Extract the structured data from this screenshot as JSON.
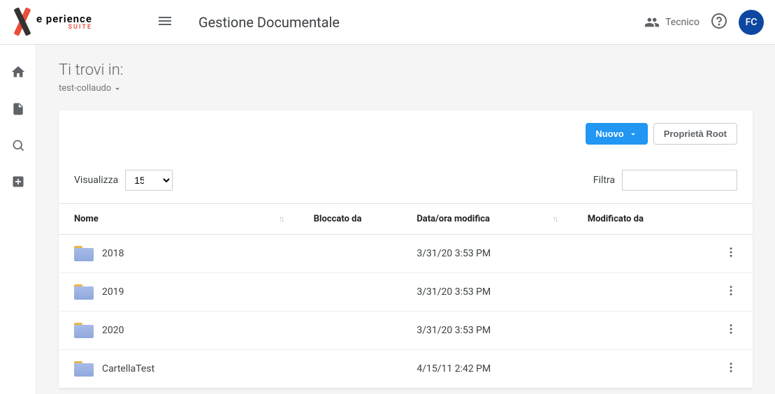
{
  "header": {
    "app_title": "Gestione Documentale",
    "user_role": "Tecnico",
    "avatar_initials": "FC"
  },
  "breadcrumb": {
    "title": "Ti trovi in:",
    "path": "test-collaudo"
  },
  "actions": {
    "new_label": "Nuovo",
    "root_props_label": "Proprietà Root"
  },
  "controls": {
    "show_label": "Visualizza",
    "page_size": "15",
    "filter_label": "Filtra"
  },
  "columns": {
    "name": "Nome",
    "locked_by": "Bloccato da",
    "modified_at": "Data/ora modifica",
    "modified_by": "Modificato da"
  },
  "rows": [
    {
      "name": "2018",
      "locked_by": "",
      "modified_at": "3/31/20 3:53 PM",
      "modified_by": ""
    },
    {
      "name": "2019",
      "locked_by": "",
      "modified_at": "3/31/20 3:53 PM",
      "modified_by": ""
    },
    {
      "name": "2020",
      "locked_by": "",
      "modified_at": "3/31/20 3:53 PM",
      "modified_by": ""
    },
    {
      "name": "CartellaTest",
      "locked_by": "",
      "modified_at": "4/15/11 2:42 PM",
      "modified_by": ""
    }
  ]
}
